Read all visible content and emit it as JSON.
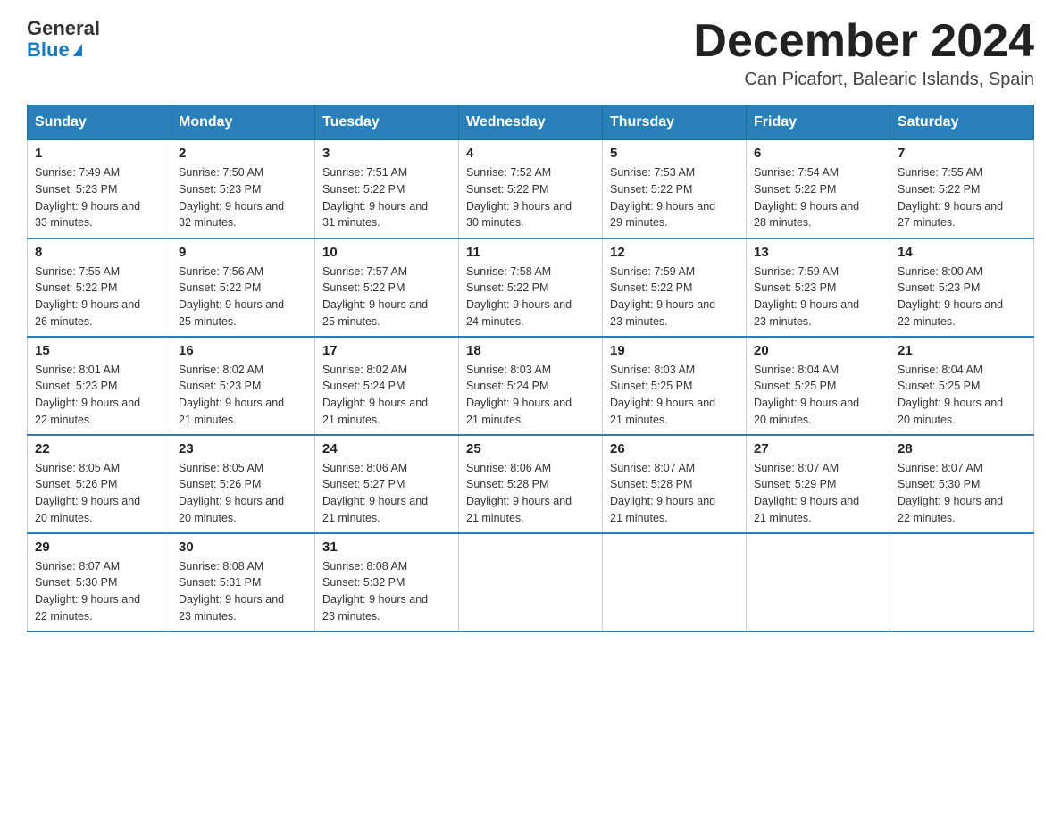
{
  "header": {
    "logo_general": "General",
    "logo_blue": "Blue",
    "month_title": "December 2024",
    "location": "Can Picafort, Balearic Islands, Spain"
  },
  "weekdays": [
    "Sunday",
    "Monday",
    "Tuesday",
    "Wednesday",
    "Thursday",
    "Friday",
    "Saturday"
  ],
  "weeks": [
    [
      {
        "day": "1",
        "sunrise": "7:49 AM",
        "sunset": "5:23 PM",
        "daylight": "9 hours and 33 minutes."
      },
      {
        "day": "2",
        "sunrise": "7:50 AM",
        "sunset": "5:23 PM",
        "daylight": "9 hours and 32 minutes."
      },
      {
        "day": "3",
        "sunrise": "7:51 AM",
        "sunset": "5:22 PM",
        "daylight": "9 hours and 31 minutes."
      },
      {
        "day": "4",
        "sunrise": "7:52 AM",
        "sunset": "5:22 PM",
        "daylight": "9 hours and 30 minutes."
      },
      {
        "day": "5",
        "sunrise": "7:53 AM",
        "sunset": "5:22 PM",
        "daylight": "9 hours and 29 minutes."
      },
      {
        "day": "6",
        "sunrise": "7:54 AM",
        "sunset": "5:22 PM",
        "daylight": "9 hours and 28 minutes."
      },
      {
        "day": "7",
        "sunrise": "7:55 AM",
        "sunset": "5:22 PM",
        "daylight": "9 hours and 27 minutes."
      }
    ],
    [
      {
        "day": "8",
        "sunrise": "7:55 AM",
        "sunset": "5:22 PM",
        "daylight": "9 hours and 26 minutes."
      },
      {
        "day": "9",
        "sunrise": "7:56 AM",
        "sunset": "5:22 PM",
        "daylight": "9 hours and 25 minutes."
      },
      {
        "day": "10",
        "sunrise": "7:57 AM",
        "sunset": "5:22 PM",
        "daylight": "9 hours and 25 minutes."
      },
      {
        "day": "11",
        "sunrise": "7:58 AM",
        "sunset": "5:22 PM",
        "daylight": "9 hours and 24 minutes."
      },
      {
        "day": "12",
        "sunrise": "7:59 AM",
        "sunset": "5:22 PM",
        "daylight": "9 hours and 23 minutes."
      },
      {
        "day": "13",
        "sunrise": "7:59 AM",
        "sunset": "5:23 PM",
        "daylight": "9 hours and 23 minutes."
      },
      {
        "day": "14",
        "sunrise": "8:00 AM",
        "sunset": "5:23 PM",
        "daylight": "9 hours and 22 minutes."
      }
    ],
    [
      {
        "day": "15",
        "sunrise": "8:01 AM",
        "sunset": "5:23 PM",
        "daylight": "9 hours and 22 minutes."
      },
      {
        "day": "16",
        "sunrise": "8:02 AM",
        "sunset": "5:23 PM",
        "daylight": "9 hours and 21 minutes."
      },
      {
        "day": "17",
        "sunrise": "8:02 AM",
        "sunset": "5:24 PM",
        "daylight": "9 hours and 21 minutes."
      },
      {
        "day": "18",
        "sunrise": "8:03 AM",
        "sunset": "5:24 PM",
        "daylight": "9 hours and 21 minutes."
      },
      {
        "day": "19",
        "sunrise": "8:03 AM",
        "sunset": "5:25 PM",
        "daylight": "9 hours and 21 minutes."
      },
      {
        "day": "20",
        "sunrise": "8:04 AM",
        "sunset": "5:25 PM",
        "daylight": "9 hours and 20 minutes."
      },
      {
        "day": "21",
        "sunrise": "8:04 AM",
        "sunset": "5:25 PM",
        "daylight": "9 hours and 20 minutes."
      }
    ],
    [
      {
        "day": "22",
        "sunrise": "8:05 AM",
        "sunset": "5:26 PM",
        "daylight": "9 hours and 20 minutes."
      },
      {
        "day": "23",
        "sunrise": "8:05 AM",
        "sunset": "5:26 PM",
        "daylight": "9 hours and 20 minutes."
      },
      {
        "day": "24",
        "sunrise": "8:06 AM",
        "sunset": "5:27 PM",
        "daylight": "9 hours and 21 minutes."
      },
      {
        "day": "25",
        "sunrise": "8:06 AM",
        "sunset": "5:28 PM",
        "daylight": "9 hours and 21 minutes."
      },
      {
        "day": "26",
        "sunrise": "8:07 AM",
        "sunset": "5:28 PM",
        "daylight": "9 hours and 21 minutes."
      },
      {
        "day": "27",
        "sunrise": "8:07 AM",
        "sunset": "5:29 PM",
        "daylight": "9 hours and 21 minutes."
      },
      {
        "day": "28",
        "sunrise": "8:07 AM",
        "sunset": "5:30 PM",
        "daylight": "9 hours and 22 minutes."
      }
    ],
    [
      {
        "day": "29",
        "sunrise": "8:07 AM",
        "sunset": "5:30 PM",
        "daylight": "9 hours and 22 minutes."
      },
      {
        "day": "30",
        "sunrise": "8:08 AM",
        "sunset": "5:31 PM",
        "daylight": "9 hours and 23 minutes."
      },
      {
        "day": "31",
        "sunrise": "8:08 AM",
        "sunset": "5:32 PM",
        "daylight": "9 hours and 23 minutes."
      },
      null,
      null,
      null,
      null
    ]
  ]
}
